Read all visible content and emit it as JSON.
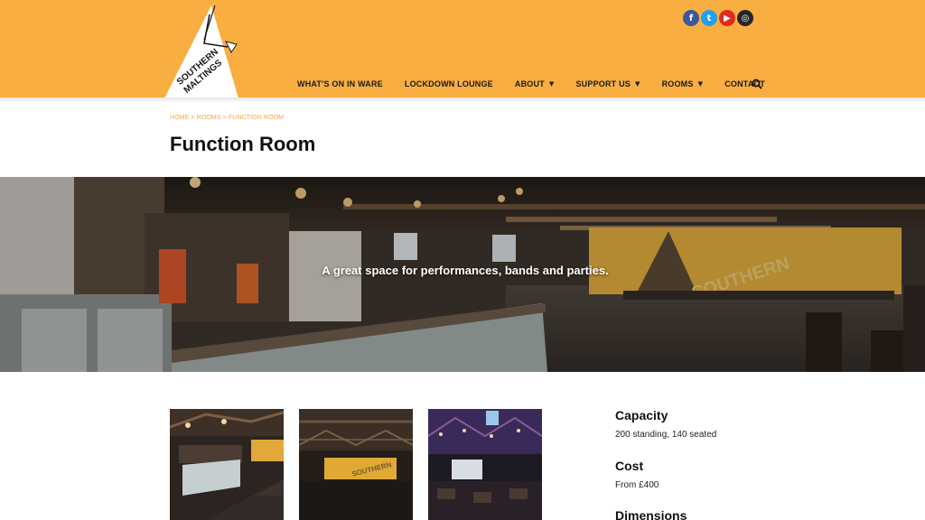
{
  "logo": {
    "text_line1": "SOUTHERN",
    "text_line2": "MALTINGS"
  },
  "social": {
    "facebook": {
      "icon": "facebook-icon",
      "glyph": "f"
    },
    "twitter": {
      "icon": "twitter-icon",
      "glyph": "t"
    },
    "youtube": {
      "icon": "youtube-icon",
      "glyph": "▶"
    },
    "instagram": {
      "icon": "instagram-icon",
      "glyph": "◎"
    }
  },
  "nav": {
    "items": [
      {
        "label": "WHAT'S ON IN WARE",
        "dropdown": false
      },
      {
        "label": "LOCKDOWN LOUNGE",
        "dropdown": false
      },
      {
        "label": "ABOUT",
        "dropdown": true
      },
      {
        "label": "SUPPORT US",
        "dropdown": true
      },
      {
        "label": "ROOMS",
        "dropdown": true
      },
      {
        "label": "CONTACT",
        "dropdown": false
      }
    ],
    "caret": "▼",
    "search_icon": "search-icon"
  },
  "breadcrumb": {
    "home": "HOME",
    "sep": " > ",
    "rooms": "ROOMS",
    "current": "FUNCTION ROOM"
  },
  "page": {
    "title": "Function Room"
  },
  "hero": {
    "tagline": "A great space for performances, bands and parties."
  },
  "info": {
    "capacity_heading": "Capacity",
    "capacity_value": "200 standing, 140 seated",
    "cost_heading": "Cost",
    "cost_value": "From £400",
    "dimensions_heading": "Dimensions"
  },
  "colors": {
    "brand": "#f9ae41",
    "breadcrumb": "#f0a64a",
    "text": "#111111"
  }
}
